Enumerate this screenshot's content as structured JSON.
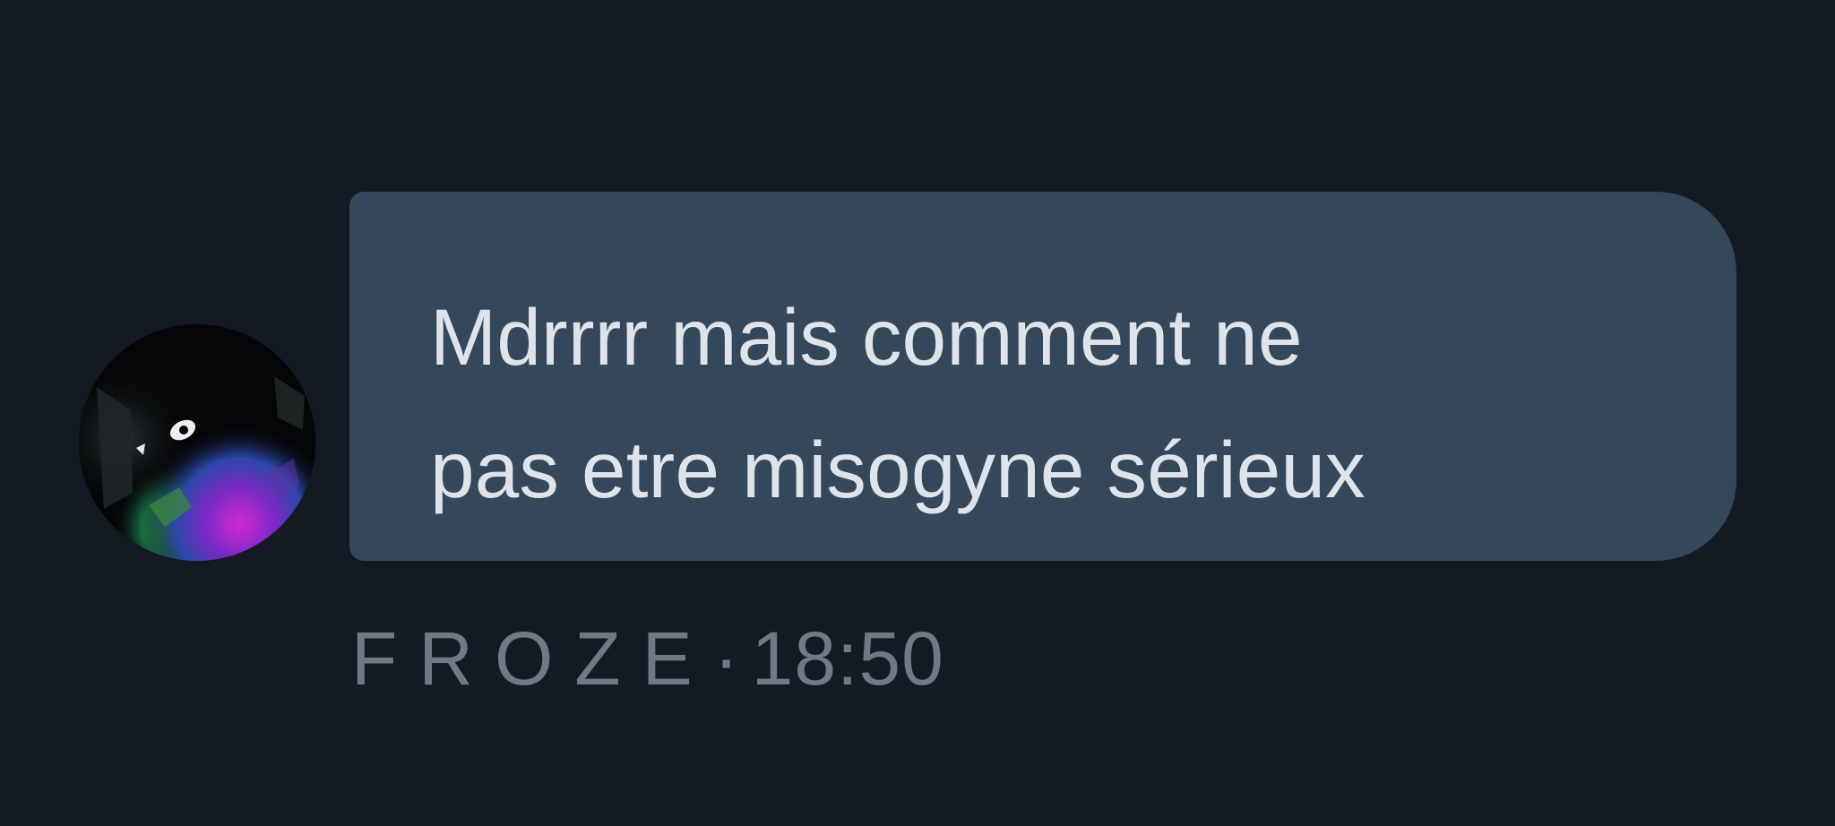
{
  "message": {
    "text": "Mdrrrr mais comment ne\npas etre misogyne sérieux",
    "author": "FROZE",
    "separator": "·",
    "time": "18:50",
    "avatar_icon": "avatar-image-icon"
  },
  "colors": {
    "background": "#141a23",
    "bubble": "#35475a",
    "bubble_text": "#dfe4ea",
    "meta_text": "#6f7a86"
  }
}
